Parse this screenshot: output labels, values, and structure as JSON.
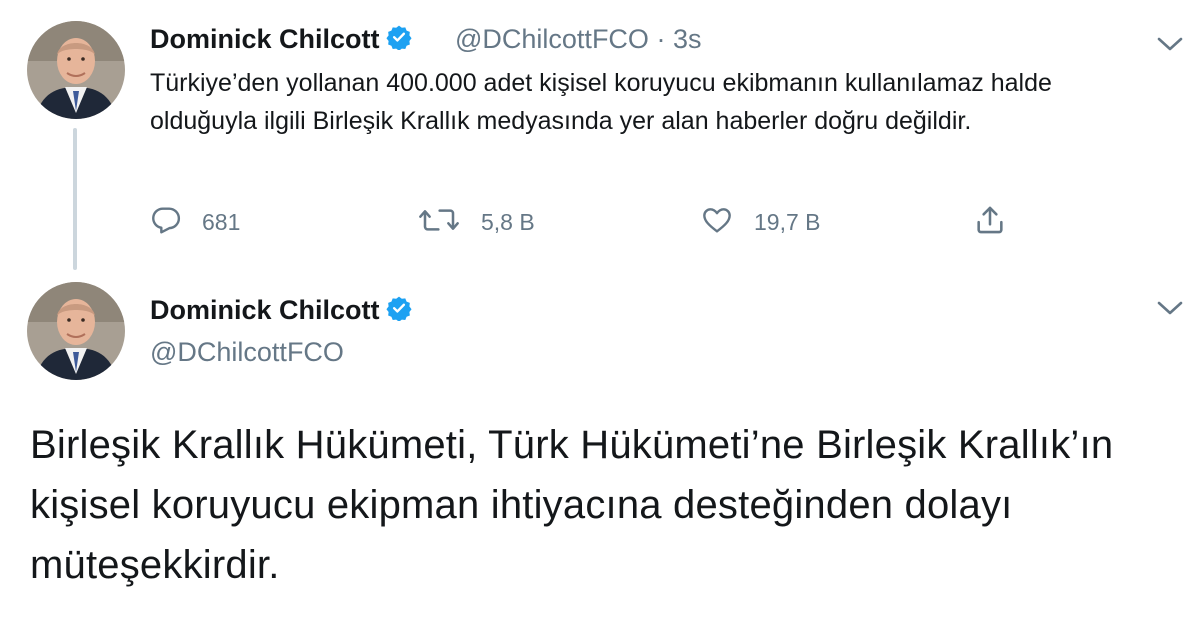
{
  "reply_tweet": {
    "author_name": "Dominick Chilcott",
    "handle": "@DChilcottFCO",
    "separator": "·",
    "time": "3s",
    "text": "Türkiye’den yollanan 400.000 adet kişisel koruyucu ekibmanın kullanılamaz halde olduğuyla ilgili Birleşik Krallık medyasında yer alan haberler doğru değildir.",
    "actions": {
      "reply_icon": "reply-icon",
      "reply_count": "681",
      "retweet_icon": "retweet-icon",
      "retweet_count": "5,8 B",
      "like_icon": "heart-icon",
      "like_count": "19,7 B",
      "share_icon": "share-icon"
    }
  },
  "main_tweet": {
    "author_name": "Dominick Chilcott",
    "handle": "@DChilcottFCO",
    "text": "Birleşik Krallık Hükümeti, Türk Hükümeti’ne Birleşik Krallık’ın kişisel koruyucu ekipman ihtiyacına desteğinden dolayı müteşekkirdir."
  },
  "colors": {
    "text_primary": "#14171a",
    "text_secondary": "#657786",
    "verified_blue": "#1da1f2",
    "thread_line": "#ccd6dd"
  }
}
